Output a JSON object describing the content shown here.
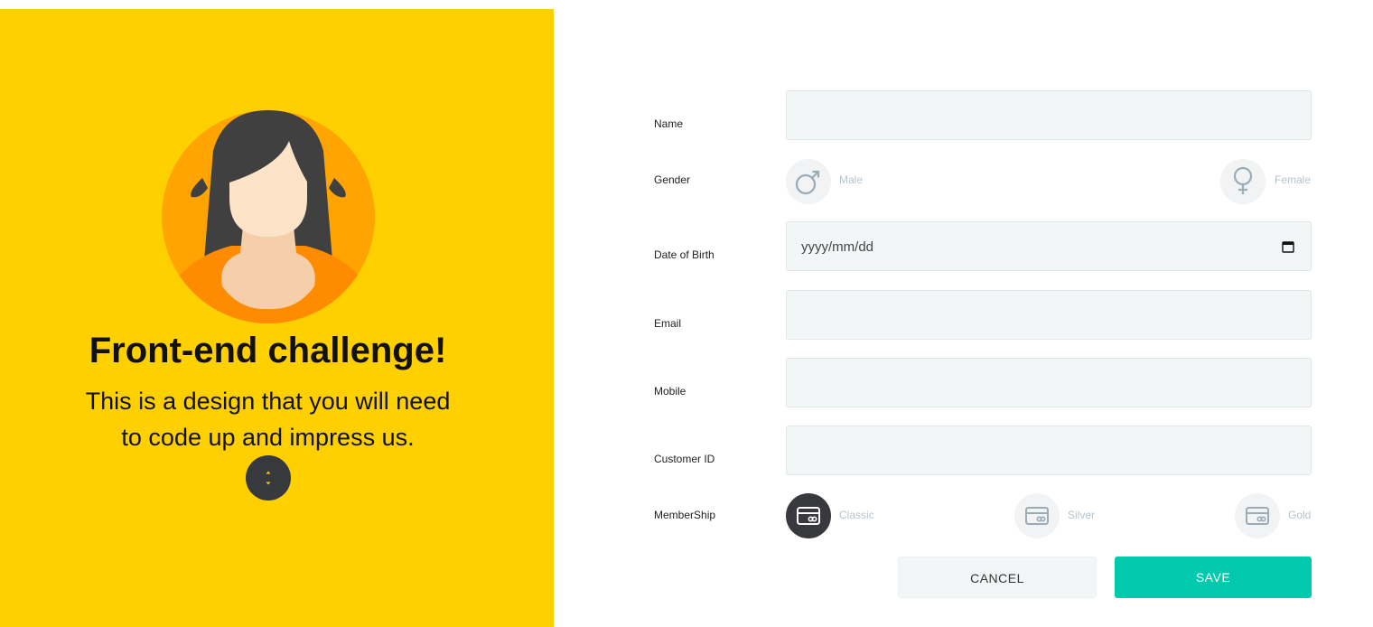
{
  "hero": {
    "title": "Front-end challenge!",
    "subtitle": "This is a design that you will need to code up and impress us."
  },
  "colors": {
    "panel": "#ffd000",
    "accent": "#00c9ad",
    "dark": "#37393d"
  },
  "form": {
    "name_label": "Name",
    "gender_label": "Gender",
    "gender_male": "Male",
    "gender_female": "Female",
    "dob_label": "Date of Birth",
    "dob_placeholder": "yyyy/mm/dd",
    "email_label": "Email",
    "mobile_label": "Mobile",
    "customer_id_label": "Customer ID",
    "membership_label": "MemberShip",
    "membership_classic": "Classic",
    "membership_silver": "Silver",
    "membership_gold": "Gold",
    "membership_selected": "Classic"
  },
  "actions": {
    "cancel": "CANCEL",
    "save": "SAVE"
  },
  "icons": {
    "avatar": "woman-avatar-icon",
    "scroll": "scroll-down-icon",
    "male": "male-icon",
    "female": "female-icon",
    "calendar": "calendar-icon",
    "card": "credit-card-icon"
  }
}
